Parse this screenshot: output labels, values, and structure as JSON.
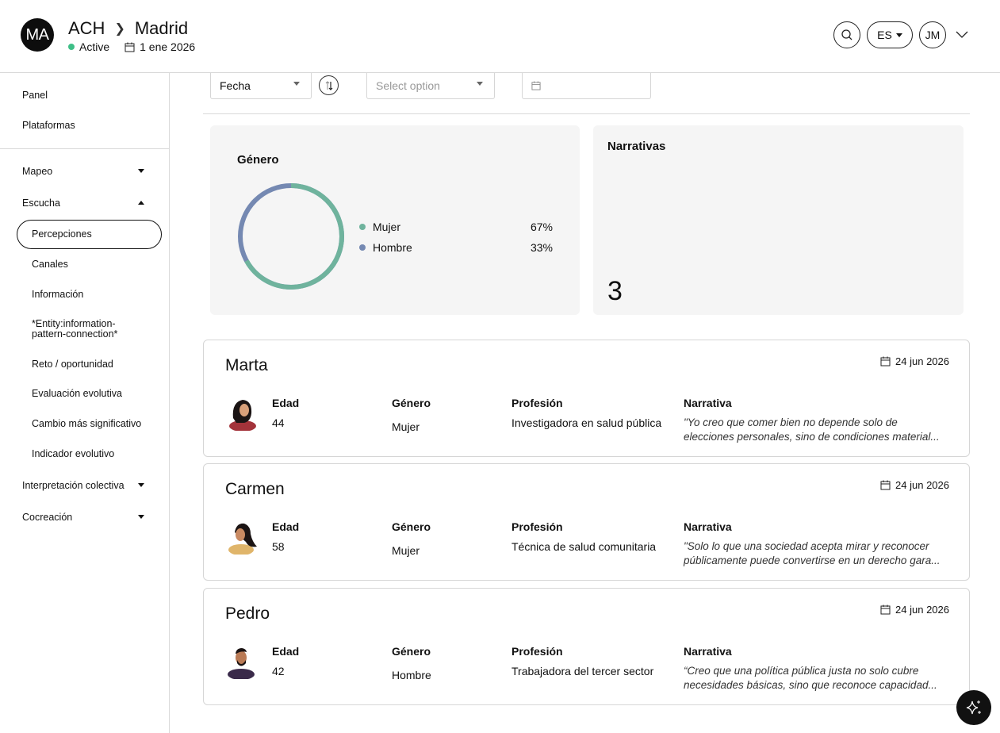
{
  "header": {
    "org_initials": "MA",
    "org_name": "ACH",
    "location": "Madrid",
    "status": "Active",
    "date": "1 ene 2026",
    "language": "ES",
    "user_initials": "JM"
  },
  "sidebar": {
    "top": [
      "Panel",
      "Plataformas"
    ],
    "mapeo": "Mapeo",
    "escucha": "Escucha",
    "escucha_items": [
      "Percepciones",
      "Canales",
      "Información",
      "*Entity:information-pattern-connection*",
      "Reto / oportunidad",
      "Evaluación evolutiva",
      "Cambio más significativo",
      "Indicador evolutivo"
    ],
    "interpretacion": "Interpretación colectiva",
    "cocreacion": "Cocreación",
    "active_item": "Percepciones"
  },
  "filters": {
    "sort_field": "Fecha",
    "option_placeholder": "Select option"
  },
  "gender_card": {
    "title": "Género",
    "legend": [
      {
        "label": "Mujer",
        "pct": "67%",
        "color": "#6fb39d"
      },
      {
        "label": "Hombre",
        "pct": "33%",
        "color": "#7589b2"
      }
    ],
    "ratio_mujer": 0.67
  },
  "narratives_card": {
    "title": "Narrativas",
    "count": "3"
  },
  "columns": {
    "age": "Edad",
    "gender": "Género",
    "profession": "Profesión",
    "narrative": "Narrativa"
  },
  "people": [
    {
      "name": "Marta",
      "date": "24 jun 2026",
      "age": "44",
      "gender": "Mujer",
      "profession": "Investigadora en salud pública",
      "narrative_l1": "\"Yo creo que comer bien no depende solo de",
      "narrative_l2": "elecciones personales, sino de condiciones material..."
    },
    {
      "name": "Carmen",
      "date": "24 jun 2026",
      "age": "58",
      "gender": "Mujer",
      "profession": "Técnica de salud comunitaria",
      "narrative_l1": "\"Solo lo que una sociedad acepta mirar y reconocer",
      "narrative_l2": "públicamente puede convertirse en un derecho gara..."
    },
    {
      "name": "Pedro",
      "date": "24 jun 2026",
      "age": "42",
      "gender": "Hombre",
      "profession": "Trabajadora del tercer sector",
      "narrative_l1": "“Creo que una política pública justa no solo cubre",
      "narrative_l2": "necesidades básicas, sino que reconoce capacidad..."
    }
  ]
}
